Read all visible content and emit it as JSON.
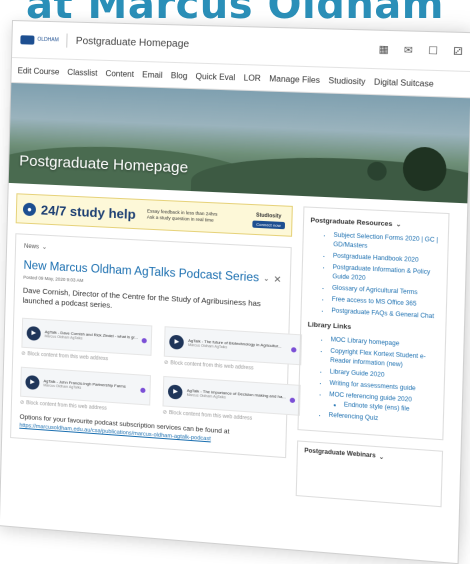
{
  "heading": "at Marcus Oldham",
  "navbar": {
    "logo_text": "OLDHAM",
    "title": "Postgraduate Homepage",
    "icons": [
      "grid-icon",
      "mail-icon",
      "chat-icon",
      "bell-icon"
    ]
  },
  "menu": [
    "Edit Course",
    "Classlist",
    "Content",
    "Email",
    "Blog",
    "Quick Eval",
    "LOR",
    "Manage Files",
    "Studiosity",
    "Digital Suitcase"
  ],
  "hero": {
    "title": "Postgraduate Homepage"
  },
  "study_banner": {
    "headline": "24/7 study help",
    "line1": "Essay feedback in less than 24hrs",
    "line2": "Ask a study question in real time",
    "brand": "Studiosity",
    "button": "Connect now"
  },
  "news": {
    "label": "News",
    "title": "New Marcus Oldham AgTalks Podcast Series",
    "posted": "Posted 09 May, 2020 9:03 AM",
    "body": "Dave Cornish, Director of the Centre for the Study of Agribusiness has launched a podcast series.",
    "podcasts": [
      {
        "title": "AgTalk - Dave Cornish and Rick Zindel - what is gr...",
        "sub": "Marcus Oldham AgTalks",
        "blocked": "Block content from this web address"
      },
      {
        "title": "AgTalk - The future of Biotechnology in Agricultur...",
        "sub": "Marcus Oldham AgTalks",
        "blocked": "Block content from this web address"
      },
      {
        "title": "AgTalk - John Francis-Ingh Partnership Farms",
        "sub": "Marcus Oldham AgTalks",
        "blocked": "Block content from this web address"
      },
      {
        "title": "AgTalk - The importance of Decision making and ha...",
        "sub": "Marcus Oldham AgTalks",
        "blocked": "Block content from this web address"
      }
    ],
    "options_text": "Options for your favourite podcast subscription services can be found at",
    "options_link": "https://marcusoldham.edu.au/csa/publications/marcus-oldham-agtalk-podcast"
  },
  "resources": {
    "title": "Postgraduate Resources",
    "items": [
      "Subject Selection Forms 2020 | GC | GD/Masters",
      "Postgraduate Handbook 2020",
      "Postgraduate Information & Policy Guide 2020",
      "Glossary of Agricultural Terms",
      "Free access to MS Office 365",
      "Postgraduate FAQs & General Chat"
    ],
    "library_title": "Library Links",
    "library_items": [
      "MOC Library homepage",
      "Copyright Flex Kortext Student e-Reader information (new)",
      "Library Guide 2020",
      "Writing for assessments guide",
      "MOC referencing guide 2020"
    ],
    "library_sub": "Endnote style (ens) file",
    "library_last": "Referencing Quiz"
  },
  "webinars": {
    "title": "Postgraduate Webinars"
  }
}
